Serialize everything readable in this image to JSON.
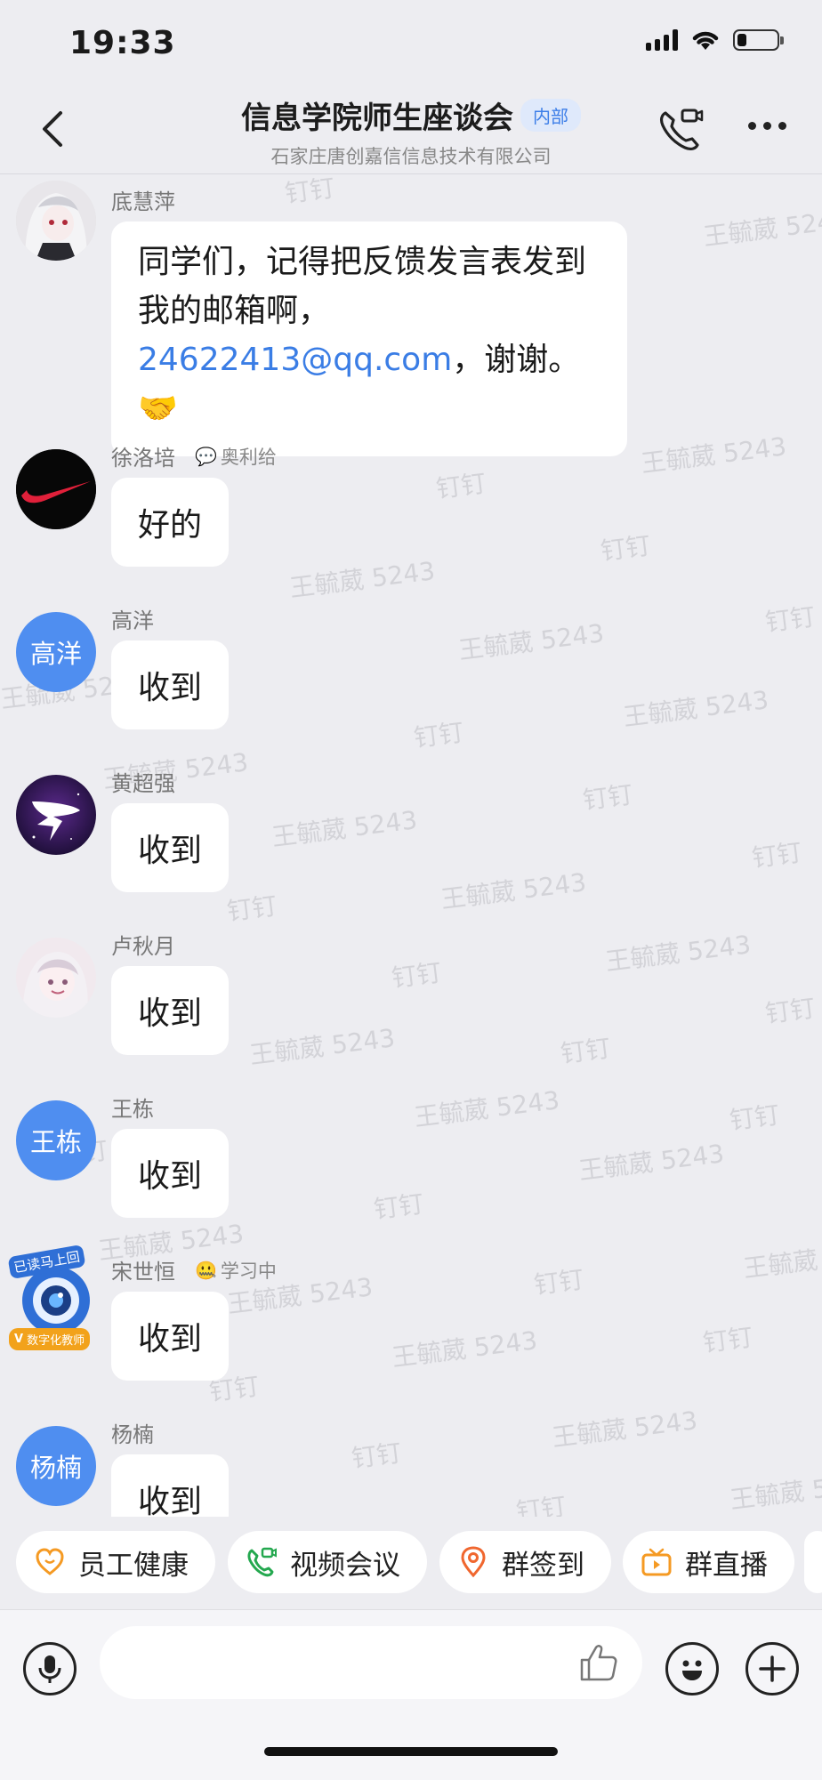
{
  "status_bar": {
    "time": "19:33",
    "battery_level": 0.25
  },
  "header": {
    "title": "信息学院师生座谈会",
    "badge": "内部",
    "subtitle": "石家庄唐创嘉信信息技术有限公司"
  },
  "watermark": {
    "name": "王毓葳 5243",
    "app": "钉钉"
  },
  "messages": [
    {
      "name": "底慧萍",
      "avatar": "anime-girl-avatar",
      "text_before": "同学们，记得把反馈发言表发到我的邮箱啊，",
      "link": "24622413@qq.com",
      "text_after": "，谢谢。🤝"
    },
    {
      "name": "徐洛培",
      "avatar": "nike-logo-avatar",
      "status": "奥利给",
      "text": "好的"
    },
    {
      "name": "高洋",
      "avatar_text": "高洋",
      "text": "收到"
    },
    {
      "name": "黄超强",
      "avatar": "dingtalk-logo-avatar",
      "text": "收到"
    },
    {
      "name": "卢秋月",
      "avatar": "anime-girl-avatar-2",
      "text": "收到"
    },
    {
      "name": "王栋",
      "avatar_text": "王栋",
      "text": "收到"
    },
    {
      "name": "宋世恒",
      "avatar": "camera-character-avatar",
      "avatar_caption_top": "已读马上回",
      "avatar_caption_bottom": "数字化教师",
      "status": "学习中",
      "text": "收到"
    },
    {
      "name": "杨楠",
      "avatar_text": "杨楠",
      "text": "收到"
    }
  ],
  "quick_actions": [
    {
      "label": "员工健康",
      "icon": "heart-icon",
      "color": "#f59a23"
    },
    {
      "label": "视频会议",
      "icon": "video-phone-icon",
      "color": "#24a84f"
    },
    {
      "label": "群签到",
      "icon": "location-pin-icon",
      "color": "#f0672f"
    },
    {
      "label": "群直播",
      "icon": "tv-live-icon",
      "color": "#f59a23"
    }
  ],
  "input_bar": {
    "mic_icon": "microphone-icon",
    "like_icon": "thumbs-up-icon",
    "emoji_icon": "emoji-icon",
    "plus_icon": "plus-icon"
  }
}
